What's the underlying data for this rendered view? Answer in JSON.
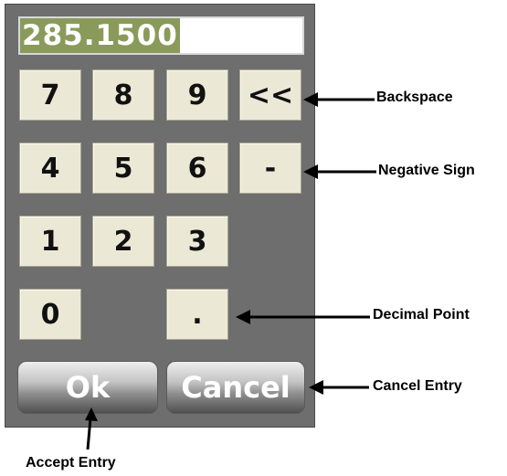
{
  "display": {
    "value": "285.1500"
  },
  "keys": {
    "k7": "7",
    "k8": "8",
    "k9": "9",
    "backspace": "<<",
    "k4": "4",
    "k5": "5",
    "k6": "6",
    "negative": "-",
    "k1": "1",
    "k2": "2",
    "k3": "3",
    "k0": "0",
    "decimal": "."
  },
  "buttons": {
    "ok": "Ok",
    "cancel": "Cancel"
  },
  "callouts": {
    "backspace": "Backspace",
    "negative": "Negative Sign",
    "decimal": "Decimal Point",
    "cancel": "Cancel Entry",
    "accept": "Accept Entry"
  },
  "colors": {
    "panel": "#6e6e6e",
    "key_face": "#ece8d6",
    "display_highlight": "#8a9a5b"
  }
}
